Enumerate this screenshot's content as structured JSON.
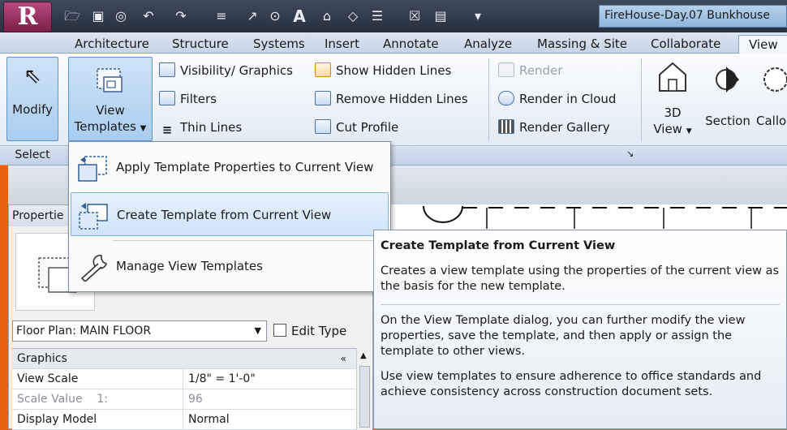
{
  "qat": {
    "app_letter": "R",
    "title": "FireHouse-Day.07 Bunkhouse"
  },
  "tabs": [
    {
      "label": "Architecture"
    },
    {
      "label": "Structure"
    },
    {
      "label": "Systems"
    },
    {
      "label": "Insert"
    },
    {
      "label": "Annotate"
    },
    {
      "label": "Analyze"
    },
    {
      "label": "Massing & Site"
    },
    {
      "label": "Collaborate"
    },
    {
      "label": "View"
    }
  ],
  "ribbon": {
    "modify_label": "Modify",
    "view_templates_label1": "View",
    "view_templates_label2": "Templates",
    "visibility_graphics": "Visibility/ Graphics",
    "filters": "Filters",
    "thin_lines": "Thin Lines",
    "show_hidden_lines": "Show Hidden Lines",
    "remove_hidden_lines": "Remove Hidden Lines",
    "cut_profile": "Cut Profile",
    "render": "Render",
    "render_in_cloud": "Render in Cloud",
    "render_gallery": "Render Gallery",
    "view_3d_label1": "3D",
    "view_3d_label2": "View",
    "section_label": "Section",
    "callout_label": "Callo",
    "select_panel": "Select"
  },
  "menu": {
    "items": [
      {
        "label": "Apply Template Properties to Current View"
      },
      {
        "label": "Create Template from Current View"
      },
      {
        "label": "Manage View Templates"
      }
    ]
  },
  "properties": {
    "title": "Propertie",
    "type_selector": "Floor Plan: MAIN FLOOR",
    "edit_type": "Edit Type",
    "rows": [
      {
        "key": "Graphics",
        "value": ""
      },
      {
        "key": "View Scale",
        "value": "1/8\" = 1'-0\""
      },
      {
        "key": "Scale Value    1:",
        "value": "96"
      },
      {
        "key": "Display Model",
        "value": "Normal"
      }
    ]
  },
  "tooltip": {
    "title": "Create Template from Current View",
    "p1": "Creates a view template using the properties of the current view as the basis for the new template.",
    "p2": "On the View Template dialog, you can further modify the view properties, save the template, and then apply or assign the template to other views.",
    "p3": "Use view templates to ensure adherence to office standards and achieve consistency across construction document sets."
  }
}
